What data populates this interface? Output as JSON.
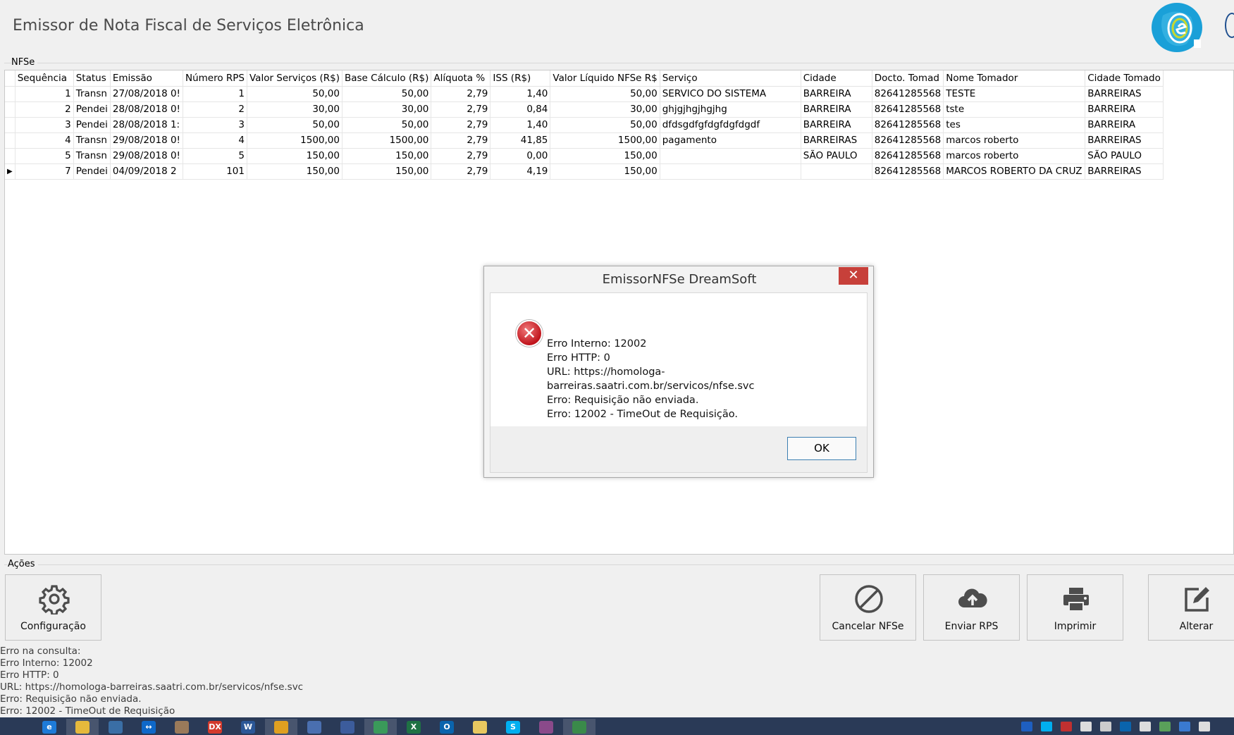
{
  "app": {
    "title": "Emissor de Nota Fiscal de Serviços Eletrônica"
  },
  "nfse_group": {
    "label": "NFSe",
    "columns": [
      "Sequência",
      "Status",
      "Emissão",
      "Número RPS",
      "Valor Serviços (R$)",
      "Base Cálculo (R$)",
      "Alíquota %",
      "ISS (R$)",
      "Valor Líquido NFSe R$",
      "Serviço",
      "Cidade",
      "Docto. Tomad",
      "Nome Tomador",
      "Cidade Tomado"
    ],
    "rows": [
      {
        "seq": "1",
        "status": "Transn",
        "emissao": "27/08/2018 0!",
        "rps": "1",
        "valor": "50,00",
        "base": "50,00",
        "aliquota": "2,79",
        "iss": "1,40",
        "liquido": "50,00",
        "servico": "SERVICO DO SISTEMA",
        "cidade": "BARREIRA",
        "docto": "82641285568",
        "tomador": "TESTE",
        "cidade_tomador": "BARREIRAS",
        "current": false
      },
      {
        "seq": "2",
        "status": "Pendei",
        "emissao": "28/08/2018 0!",
        "rps": "2",
        "valor": "30,00",
        "base": "30,00",
        "aliquota": "2,79",
        "iss": "0,84",
        "liquido": "30,00",
        "servico": "ghjgjhgjhgjhg",
        "cidade": "BARREIRA",
        "docto": "82641285568",
        "tomador": "tste",
        "cidade_tomador": "BARREIRA",
        "current": false
      },
      {
        "seq": "3",
        "status": "Pendei",
        "emissao": "28/08/2018 1:",
        "rps": "3",
        "valor": "50,00",
        "base": "50,00",
        "aliquota": "2,79",
        "iss": "1,40",
        "liquido": "50,00",
        "servico": "dfdsgdfgfdgfdgfdgdf",
        "cidade": "BARREIRA",
        "docto": "82641285568",
        "tomador": "tes",
        "cidade_tomador": "BARREIRA",
        "current": false
      },
      {
        "seq": "4",
        "status": "Transn",
        "emissao": "29/08/2018 0!",
        "rps": "4",
        "valor": "1500,00",
        "base": "1500,00",
        "aliquota": "2,79",
        "iss": "41,85",
        "liquido": "1500,00",
        "servico": "pagamento",
        "cidade": "BARREIRAS",
        "docto": "82641285568",
        "tomador": "marcos roberto",
        "cidade_tomador": "BARREIRAS",
        "current": false
      },
      {
        "seq": "5",
        "status": "Transn",
        "emissao": "29/08/2018 0!",
        "rps": "5",
        "valor": "150,00",
        "base": "150,00",
        "aliquota": "2,79",
        "iss": "0,00",
        "liquido": "150,00",
        "servico": "",
        "cidade": "SÃO PAULO",
        "docto": "82641285568",
        "tomador": "marcos roberto",
        "cidade_tomador": "SÃO PAULO",
        "current": false
      },
      {
        "seq": "7",
        "status": "Pendei",
        "emissao": "04/09/2018 2",
        "rps": "101",
        "valor": "150,00",
        "base": "150,00",
        "aliquota": "2,79",
        "iss": "4,19",
        "liquido": "150,00",
        "servico": "",
        "cidade": "",
        "docto": "82641285568",
        "tomador": "MARCOS ROBERTO DA CRUZ",
        "cidade_tomador": "BARREIRAS",
        "current": true
      }
    ]
  },
  "dialog": {
    "title": "EmissorNFSe DreamSoft",
    "close_glyph": "✕",
    "error_glyph": "✕",
    "lines": [
      "Erro Interno: 12002",
      "Erro HTTP: 0",
      "URL: https://homologa-barreiras.saatri.com.br/servicos/nfse.svc",
      "Erro: Requisição não enviada.",
      "Erro: 12002 - TimeOut de Requisição."
    ],
    "ok_label": "OK"
  },
  "actions": {
    "label": "Ações",
    "buttons": [
      {
        "name": "configuracao",
        "label": "Configuração",
        "icon": "gear-icon"
      },
      {
        "name": "cancelar-nfse",
        "label": "Cancelar NFSe",
        "icon": "cancel-icon"
      },
      {
        "name": "enviar-rps",
        "label": "Enviar RPS",
        "icon": "cloud-upload-icon"
      },
      {
        "name": "imprimir",
        "label": "Imprimir",
        "icon": "printer-icon"
      },
      {
        "name": "alterar",
        "label": "Alterar",
        "icon": "edit-icon"
      }
    ]
  },
  "log": {
    "lines": [
      "Erro na consulta:",
      "Erro Interno: 12002",
      "Erro HTTP: 0",
      "URL: https://homologa-barreiras.saatri.com.br/servicos/nfse.svc",
      "Erro: Requisição não enviada.",
      "Erro: 12002 - TimeOut de Requisição"
    ]
  },
  "taskbar": {
    "items": [
      {
        "name": "start-icon",
        "glyph": "",
        "color": "#2a3a57"
      },
      {
        "name": "ie-icon",
        "glyph": "e",
        "color": "#1e7bd8"
      },
      {
        "name": "file-explorer-icon",
        "glyph": "",
        "color": "#e5b93c"
      },
      {
        "name": "globe-icon",
        "glyph": "",
        "color": "#3a6ea5"
      },
      {
        "name": "teamviewer-icon",
        "glyph": "↔",
        "color": "#0e68c9"
      },
      {
        "name": "usb-icon",
        "glyph": "",
        "color": "#9a7a5a"
      },
      {
        "name": "devexpress-icon",
        "glyph": "DX",
        "color": "#d33a2c"
      },
      {
        "name": "word-icon",
        "glyph": "W",
        "color": "#2b5797"
      },
      {
        "name": "chrome-icon",
        "glyph": "",
        "color": "#e0a020"
      },
      {
        "name": "network-tool-icon",
        "glyph": "",
        "color": "#4a6fb0"
      },
      {
        "name": "vs-icon",
        "glyph": "",
        "color": "#3c5c9c"
      },
      {
        "name": "app-icon",
        "glyph": "",
        "color": "#3a9a5a"
      },
      {
        "name": "excel-icon",
        "glyph": "X",
        "color": "#1f7244"
      },
      {
        "name": "outlook-icon",
        "glyph": "O",
        "color": "#0a64ad"
      },
      {
        "name": "folder-icon",
        "glyph": "",
        "color": "#e8c860"
      },
      {
        "name": "skype-icon",
        "glyph": "S",
        "color": "#00aff0"
      },
      {
        "name": "winrar-icon",
        "glyph": "",
        "color": "#8a4a8a"
      },
      {
        "name": "emissor-icon",
        "glyph": "",
        "color": "#3a8a4a"
      }
    ],
    "tray": [
      {
        "name": "bluetooth-icon",
        "color": "#1e5fc0"
      },
      {
        "name": "skype-tray-icon",
        "color": "#00aff0"
      },
      {
        "name": "tool-tray-icon",
        "color": "#c03030"
      },
      {
        "name": "flag-icon",
        "color": "#dddddd"
      },
      {
        "name": "network-signal-icon",
        "color": "#cccccc"
      },
      {
        "name": "outlook-tray-icon",
        "color": "#0a64ad"
      },
      {
        "name": "volume-icon",
        "color": "#dddddd"
      },
      {
        "name": "battery-icon",
        "color": "#5aa05a"
      },
      {
        "name": "monitor-icon",
        "color": "#3a7ad0"
      },
      {
        "name": "action-center-icon",
        "color": "#dddddd"
      }
    ]
  }
}
